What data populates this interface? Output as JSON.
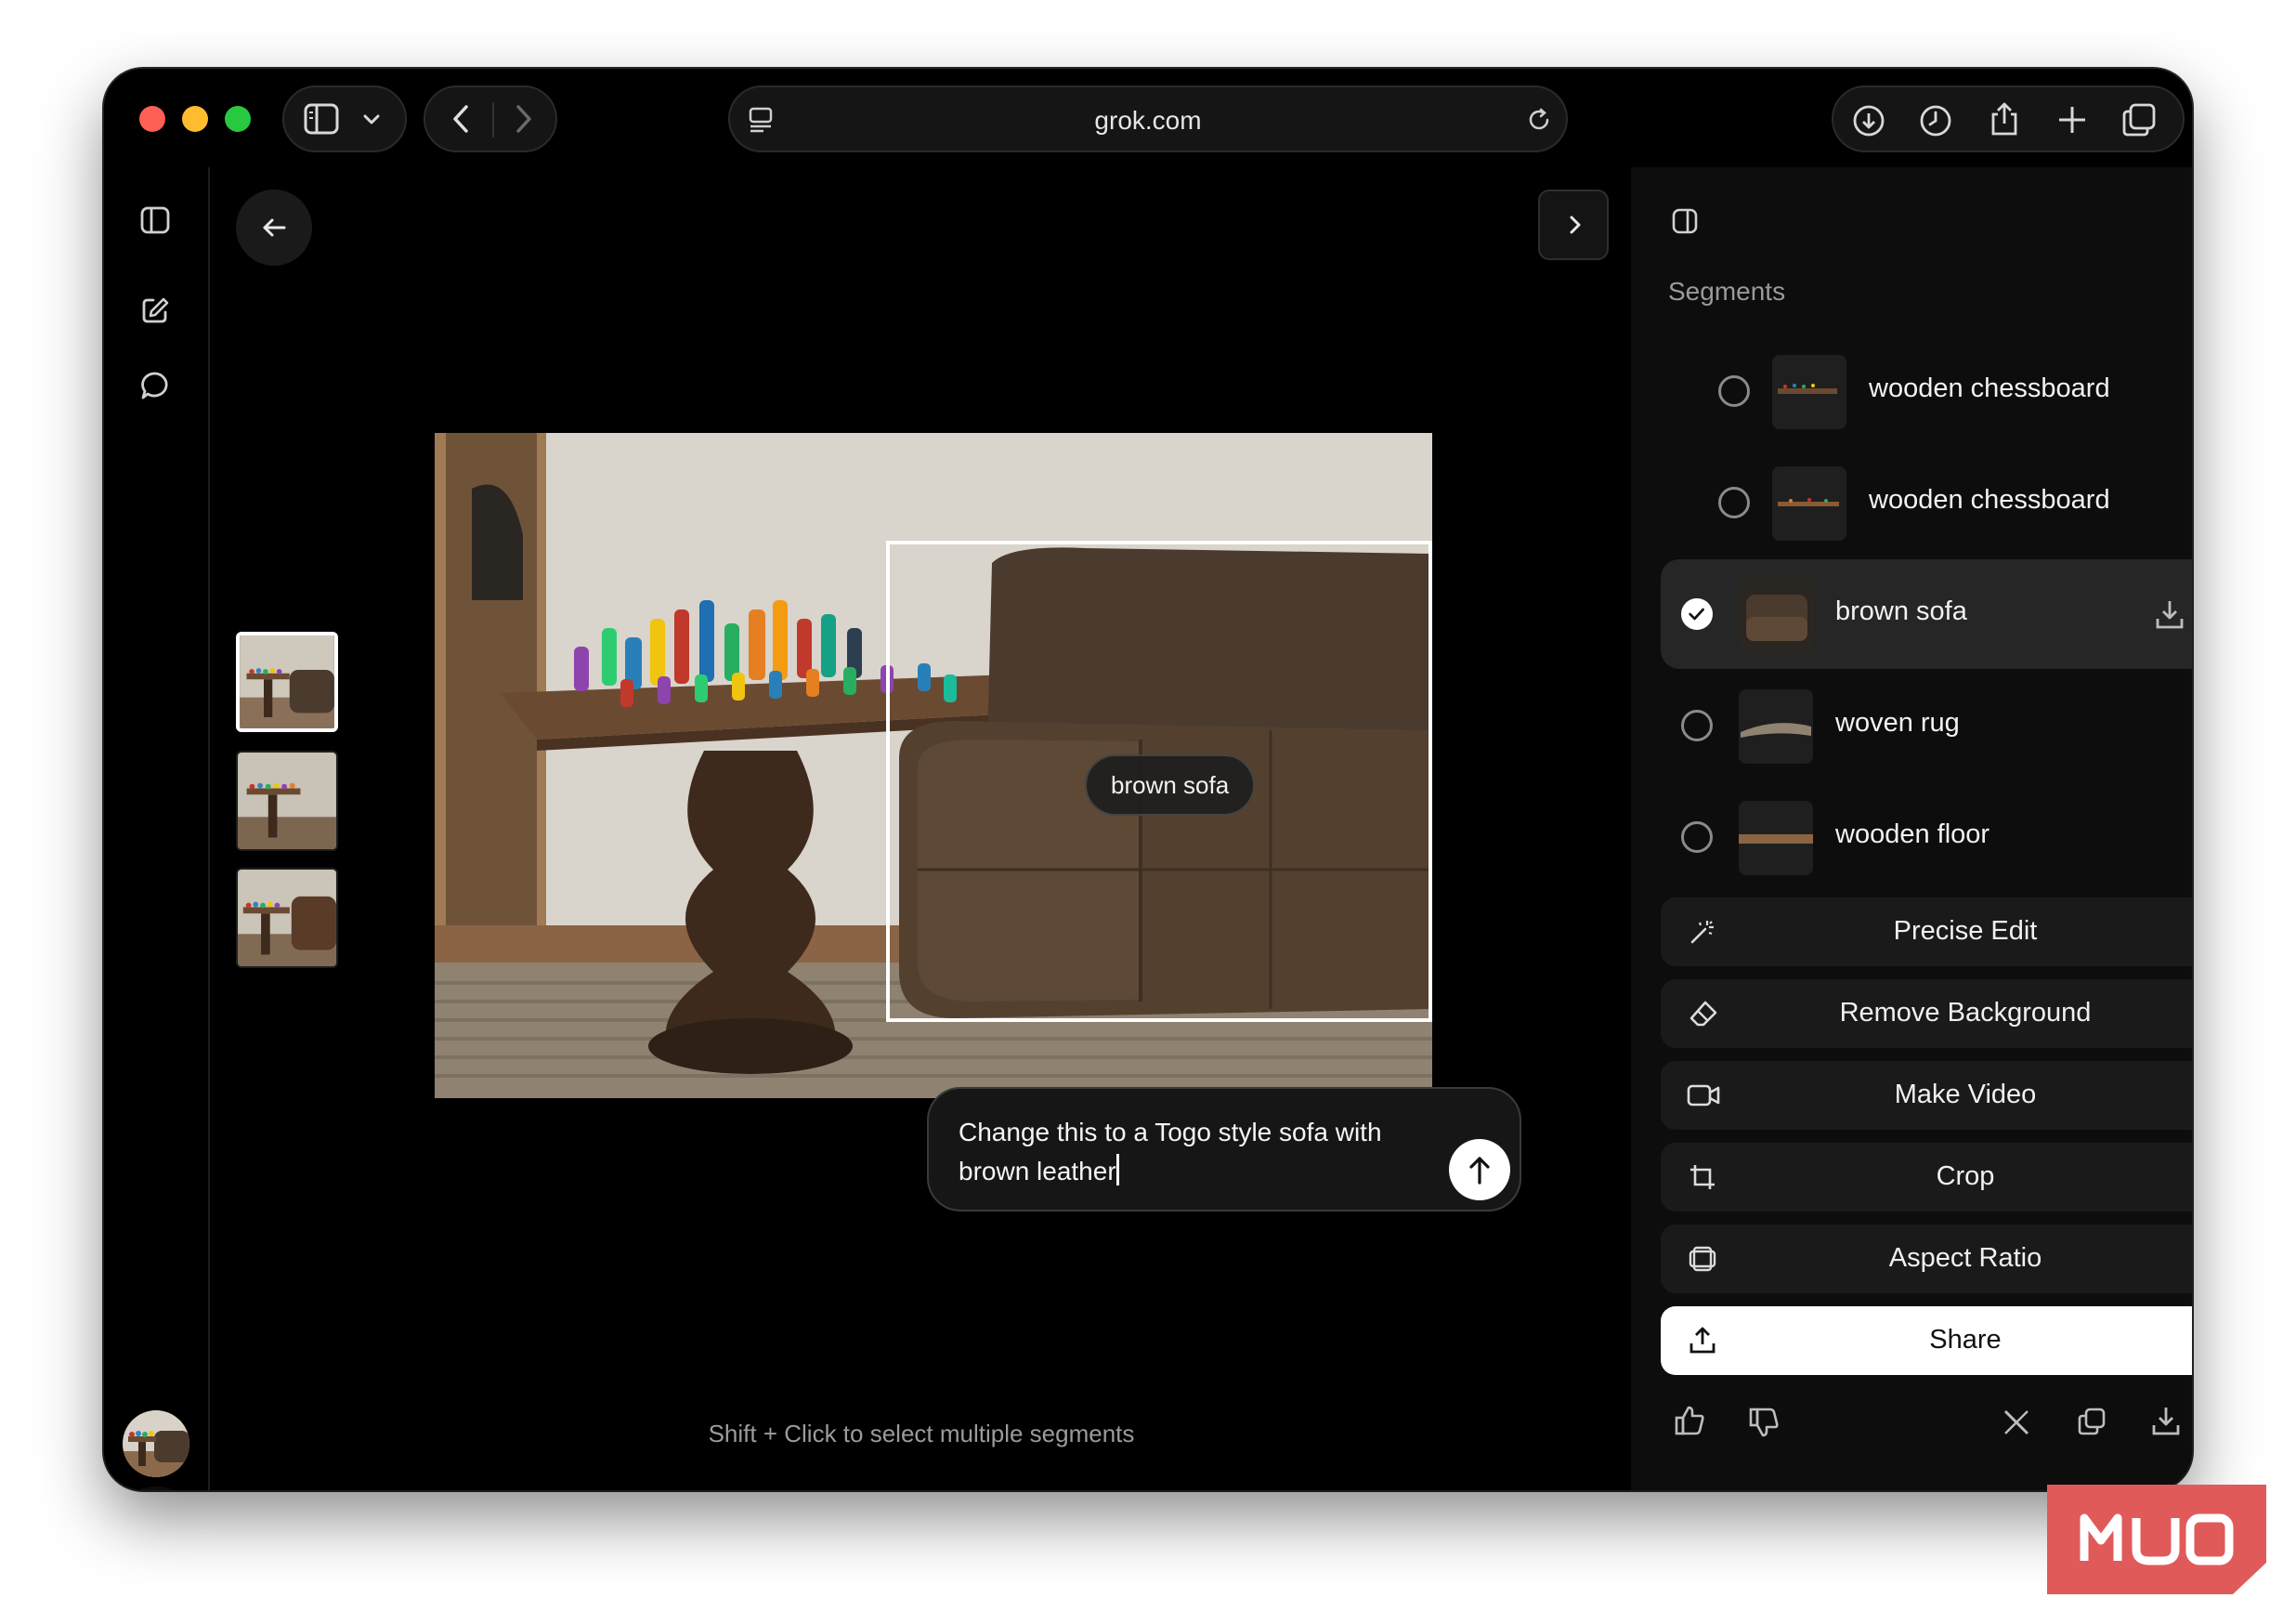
{
  "browser": {
    "address": "grok.com",
    "icons": {
      "sidebar": "sidebar-toggle-icon",
      "chevron": "chevron-down-icon",
      "back": "back-arrow-icon",
      "forward": "forward-arrow-icon",
      "page": "page-menu-icon",
      "reload": "reload-icon",
      "downloads": "download-icon",
      "history": "history-icon",
      "share": "share-icon",
      "new_tab": "plus-icon",
      "tabs": "tabs-overview-icon"
    }
  },
  "rail": {
    "icons": [
      "panel-toggle-icon",
      "new-chat-icon",
      "chat-bubble-icon"
    ]
  },
  "canvas": {
    "selection_label": "brown sofa",
    "prompt_text": "Change this to a Togo style sofa with brown leather",
    "hint": "Shift + Click to select multiple segments",
    "thumbnail_count": 3,
    "active_thumbnail": 1
  },
  "panel": {
    "heading": "Segments",
    "segments": [
      {
        "label": "wooden chessboard",
        "selected": false
      },
      {
        "label": "wooden chessboard",
        "selected": false
      },
      {
        "label": "brown sofa",
        "selected": true
      },
      {
        "label": "woven rug",
        "selected": false
      },
      {
        "label": "wooden floor",
        "selected": false
      }
    ],
    "actions": [
      {
        "label": "Precise Edit",
        "icon": "magic-wand-icon"
      },
      {
        "label": "Remove Background",
        "icon": "eraser-icon"
      },
      {
        "label": "Make Video",
        "icon": "video-camera-icon"
      },
      {
        "label": "Crop",
        "icon": "crop-icon"
      },
      {
        "label": "Aspect Ratio",
        "icon": "aspect-ratio-icon"
      }
    ],
    "share_label": "Share",
    "footer_icons": [
      "thumbs-up-icon",
      "thumbs-down-icon",
      "x-logo-icon",
      "copy-icon",
      "download-icon",
      "more-icon"
    ]
  },
  "colors": {
    "window_bg": "#000000",
    "panel_bg": "#0d0d0d",
    "selected_row": "#262626",
    "button_bg": "#1a1a1a",
    "share_bg": "#ffffff",
    "sofa_brown": "#4b3a2e"
  }
}
